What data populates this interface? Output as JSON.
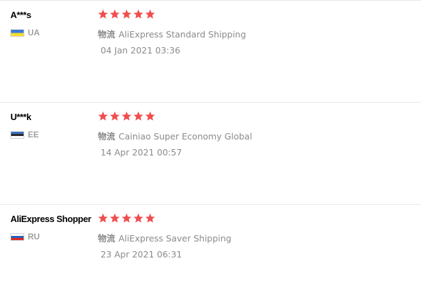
{
  "reviews": [
    {
      "name": "A***s",
      "country": "UA",
      "flag_colors": [
        "#3a7ad9",
        "#f5dd2d"
      ],
      "stars": 5,
      "shipping_prefix": "物流",
      "shipping_method": "AliExpress Standard Shipping",
      "date": "04 Jan 2021 03:36"
    },
    {
      "name": "U***k",
      "country": "EE",
      "flag_colors": [
        "#3a6ec0",
        "#2b2b2b",
        "#ffffff"
      ],
      "stars": 5,
      "shipping_prefix": "物流",
      "shipping_method": "Cainiao Super Economy Global",
      "date": "14 Apr 2021 00:57"
    },
    {
      "name": "AliExpress Shopper",
      "country": "RU",
      "flag_colors": [
        "#ffffff",
        "#2f5fb8",
        "#d82a2a"
      ],
      "stars": 5,
      "shipping_prefix": "物流",
      "shipping_method": "AliExpress Saver Shipping",
      "date": "23 Apr 2021 06:31"
    }
  ],
  "star_color": "#f04e4e"
}
